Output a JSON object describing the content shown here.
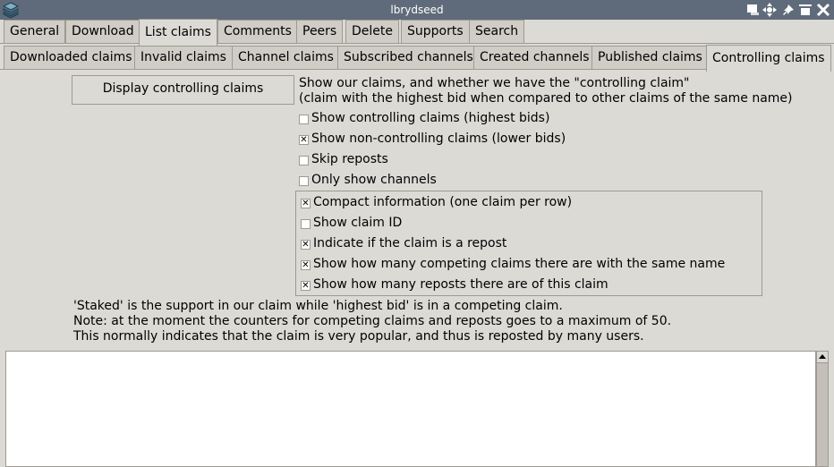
{
  "window": {
    "title": "lbrydseed"
  },
  "main_tabs": [
    "General",
    "Download",
    "List claims",
    "Comments",
    "Peers",
    "Delete",
    "Supports",
    "Search"
  ],
  "main_tabs_active": "List claims",
  "sub_tabs": [
    "Downloaded claims",
    "Invalid claims",
    "Channel claims",
    "Subscribed channels",
    "Created channels",
    "Published claims",
    "Controlling claims"
  ],
  "sub_tabs_active": "Controlling claims",
  "action_button": "Display controlling claims",
  "description": {
    "line1": "Show our claims, and whether we have the \"controlling claim\"",
    "line2": "(claim with the highest bid when compared to other claims of the same name)"
  },
  "filters": [
    {
      "label": "Show controlling claims (highest bids)",
      "checked": false
    },
    {
      "label": "Show non-controlling claims (lower bids)",
      "checked": true
    },
    {
      "label": "Skip reposts",
      "checked": false
    },
    {
      "label": "Only show channels",
      "checked": false
    }
  ],
  "options": [
    {
      "label": "Compact information (one claim per row)",
      "checked": true
    },
    {
      "label": "Show claim ID",
      "checked": false
    },
    {
      "label": "Indicate if the claim is a repost",
      "checked": true
    },
    {
      "label": "Show how many competing claims there are with the same name",
      "checked": true
    },
    {
      "label": "Show how many reposts there are of this claim",
      "checked": true
    }
  ],
  "notes": {
    "line1": "'Staked' is the support in our claim while 'highest bid' is in a competing claim.",
    "line2": "Note: at the moment the counters for competing claims and reposts goes to a maximum of 50.",
    "line3": "This normally indicates that the claim is very popular, and thus is reposted by many users."
  },
  "output_text": "",
  "icons": {
    "app": "stack-icon",
    "titlebar": [
      "window-icon",
      "move-icon",
      "pin-icon",
      "minimize-icon",
      "close-icon"
    ]
  }
}
